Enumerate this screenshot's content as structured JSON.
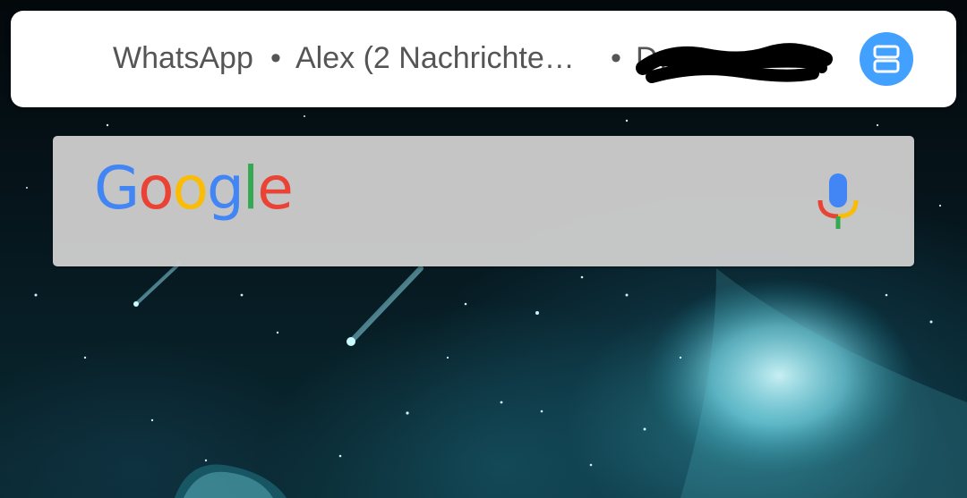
{
  "notification": {
    "app_name": "WhatsApp",
    "separator": "•",
    "message_preview": "Alex (2 Nachrichte…",
    "third_item": "D… …",
    "expand_icon": "expand-notifications-icon",
    "accent_color": "#42a0ff"
  },
  "search_widget": {
    "logo_letters": [
      "G",
      "o",
      "o",
      "g",
      "l",
      "e"
    ],
    "mic_icon": "microphone-icon"
  },
  "wallpaper": {
    "description_icon": "space-wallpaper"
  }
}
